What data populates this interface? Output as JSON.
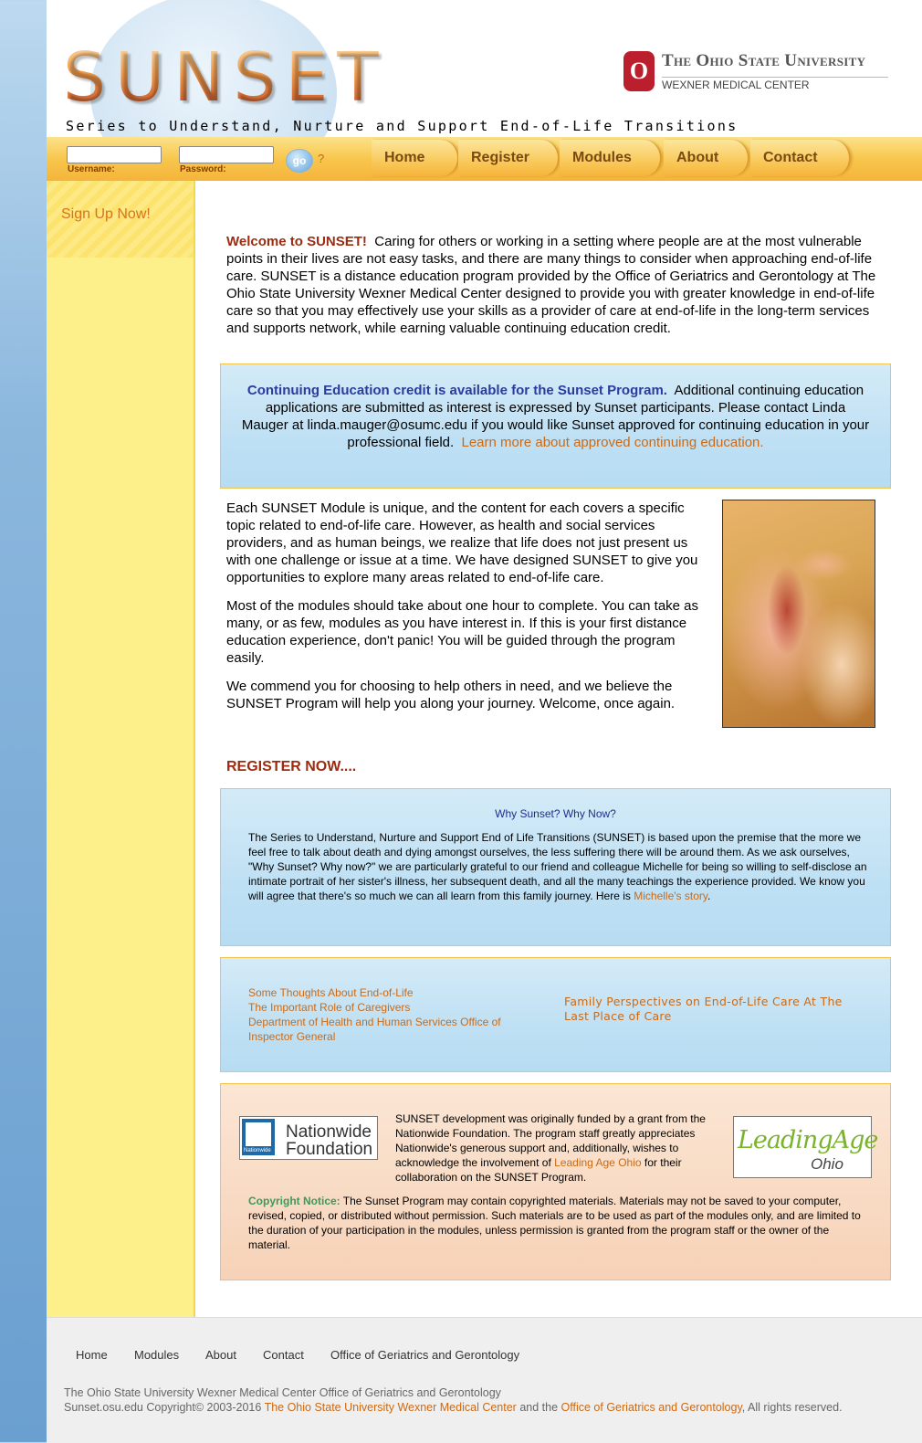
{
  "header": {
    "logo": "SUNSET",
    "tagline": "Series to Understand, Nurture and Support End-of-Life Transitions",
    "university_mark": "O",
    "university_name": "The Ohio State University",
    "university_sub": "WEXNER MEDICAL CENTER"
  },
  "login": {
    "username_label": "Username:",
    "password_label": "Password:",
    "go_label": "go",
    "help_label": "?"
  },
  "nav": [
    "Home",
    "Register",
    "Modules",
    "About",
    "Contact"
  ],
  "sidebar": {
    "signup": "Sign Up Now!"
  },
  "welcome": {
    "lead": "Welcome to SUNSET!",
    "body": "Caring for others or working in a setting where people are at the most vulnerable points in their lives are not easy tasks, and there are many things to consider when approaching end-of-life care.  SUNSET is a distance education program provided by the Office of Geriatrics and Gerontology at The Ohio State University Wexner Medical Center designed to provide you with greater knowledge in end-of-life care so that you may effectively use your skills as a provider of care at end-of-life in the long-term services and supports network, while earning valuable continuing education credit."
  },
  "ce_box": {
    "title": "Continuing Education credit is available for the Sunset Program.",
    "body": "Additional continuing education applications are submitted as interest is expressed by Sunset participants.  Please contact Linda Mauger at linda.mauger@osumc.edu if you would like Sunset approved for continuing education in your professional field.",
    "link": "Learn more about approved continuing education."
  },
  "modules_text": {
    "p1": "Each SUNSET Module is unique, and the content for each covers a specific topic related to end-of-life care. However, as health and social services providers, and as human beings, we realize that life does not just present us with one challenge or issue at a time.  We have designed SUNSET to give you opportunities to explore many areas related to end-of-life care.",
    "p2": "Most of the modules should take about one hour to complete.   You can take as many, or as few, modules as you have interest in.  If this is your first distance education experience, don't panic! You will be guided through the program easily.",
    "p3": "We commend you for choosing to help others in need, and we believe the SUNSET Program will help you along your journey. Welcome, once again."
  },
  "register_now": "REGISTER NOW....",
  "why_box": {
    "title": "Why Sunset? Why Now?",
    "body": "The Series to Understand, Nurture and Support End of Life Transitions (SUNSET) is based upon the premise that the more we feel free to talk about death and dying amongst ourselves, the less suffering there will be around them. As we ask ourselves, \"Why Sunset?  Why now?\" we are particularly grateful to our friend and colleague Michelle for being so willing to self-disclose an intimate portrait of her sister's illness, her subsequent death, and all the many teachings the experience provided. We know you will agree that there's so much we can all learn from this family journey. Here is",
    "link": "Michelle's story",
    "tail": "."
  },
  "links_box": {
    "left": [
      "Some Thoughts About End-of-Life",
      "The Important Role of Caregivers",
      "Department of Health and Human Services Office of Inspector General"
    ],
    "right": "Family Perspectives on End-of-Life Care At The Last Place of Care"
  },
  "funding": {
    "nationwide_logo": "Nationwide Foundation",
    "nationwide_mark": "Nationwide",
    "text1": "SUNSET development was originally funded by a grant from the Nationwide Foundation. The program staff greatly appreciates Nationwide's generous support and, additionally, wishes to acknowledge the involvement of",
    "link": "Leading Age Ohio",
    "text2": "for their collaboration on the SUNSET Program.",
    "leading_age_logo": "LeadingAge",
    "leading_age_sub": "Ohio",
    "copyright_label": "Copyright Notice:",
    "copyright_text": "The Sunset Program may contain copyrighted materials. Materials may not be saved to your computer, revised, copied, or distributed without permission. Such materials are to be used as part of the modules only, and are limited to the duration of your participation in the modules, unless permission is granted from the program staff or the owner of the material."
  },
  "footer": {
    "nav": [
      "Home",
      "Modules",
      "About",
      "Contact",
      "Office of Geriatrics and Gerontology"
    ],
    "line1": "The Ohio State University Wexner Medical Center Office of Geriatrics and Gerontology",
    "line2_prefix": "Sunset.osu.edu Copyright© 2003-2016",
    "line2_link1": "The Ohio State University Wexner Medical Center",
    "line2_mid": "and the",
    "line2_link2": "Office of Geriatrics and Gerontology",
    "line2_suffix": ", All rights reserved."
  },
  "colors": {
    "accent_orange": "#cc6a14",
    "nav_yellow": "#f8c64d",
    "sidebar_yellow": "#fdf08a",
    "ce_title_blue": "#2b3b9e",
    "osu_red": "#bb1f2e"
  }
}
